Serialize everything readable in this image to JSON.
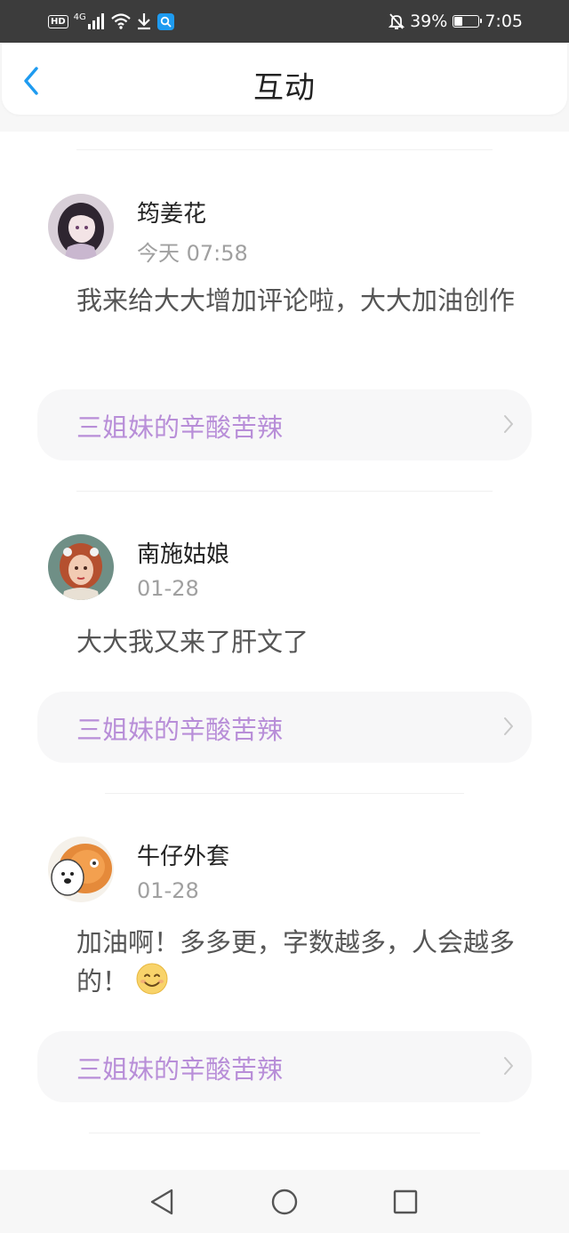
{
  "status_bar": {
    "network_badge": "HD",
    "network_type": "4G",
    "battery": "39%",
    "battery_level": 0.39,
    "time": "7:05"
  },
  "header": {
    "title": "互动"
  },
  "comments": [
    {
      "username": "筠姜花",
      "timestamp": "今天 07:58",
      "text": "我来给大大增加评论啦，大大加油创作",
      "book_title": "三姐妹的辛酸苦辣"
    },
    {
      "username": "南施姑娘",
      "timestamp": "01-28",
      "text": "大大我又来了肝文了",
      "book_title": "三姐妹的辛酸苦辣"
    },
    {
      "username": "牛仔外套",
      "timestamp": "01-28",
      "text": "加油啊！多多更，字数越多，人会越多的！",
      "book_title": "三姐妹的辛酸苦辣"
    }
  ],
  "colors": {
    "accent": "#1e9bf0",
    "book_title": "#b88ed8"
  }
}
